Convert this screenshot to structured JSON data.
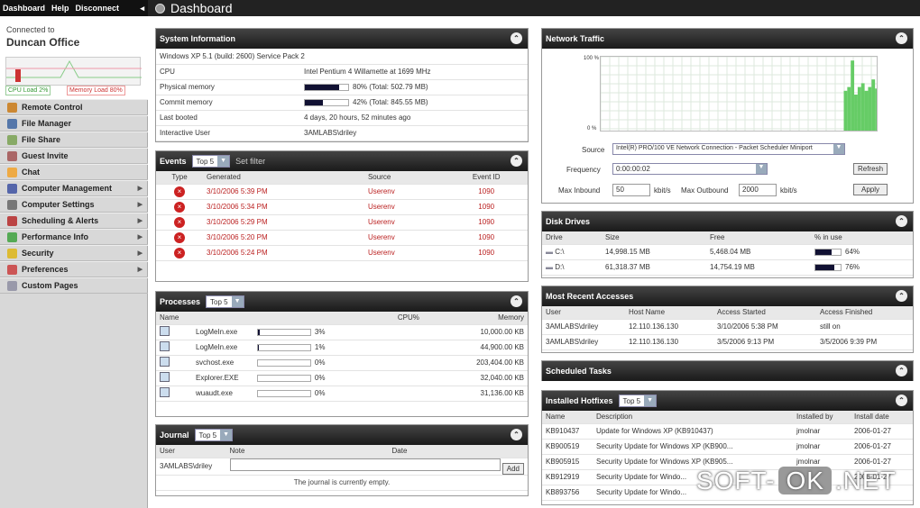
{
  "topnav": {
    "dashboard": "Dashboard",
    "help": "Help",
    "disconnect": "Disconnect",
    "arrow": "◂"
  },
  "page_title": "Dashboard",
  "sidebar": {
    "connected_to": "Connected to",
    "computer": "Duncan Office",
    "cpu_load": "CPU Load 2%",
    "memory_load": "Memory Load 80%",
    "items": [
      {
        "label": "Remote Control",
        "icon": "remote-control-icon",
        "color": "#c83",
        "arrow": false
      },
      {
        "label": "File Manager",
        "icon": "file-manager-icon",
        "color": "#57a",
        "arrow": false
      },
      {
        "label": "File Share",
        "icon": "file-share-icon",
        "color": "#8a6",
        "arrow": false
      },
      {
        "label": "Guest Invite",
        "icon": "guest-invite-icon",
        "color": "#a66",
        "arrow": false
      },
      {
        "label": "Chat",
        "icon": "chat-icon",
        "color": "#ea4",
        "arrow": false
      },
      {
        "label": "Computer Management",
        "icon": "computer-management-icon",
        "color": "#56a",
        "arrow": true
      },
      {
        "label": "Computer Settings",
        "icon": "computer-settings-icon",
        "color": "#777",
        "arrow": true
      },
      {
        "label": "Scheduling & Alerts",
        "icon": "scheduling-icon",
        "color": "#b44",
        "arrow": true
      },
      {
        "label": "Performance Info",
        "icon": "performance-icon",
        "color": "#5a5",
        "arrow": true
      },
      {
        "label": "Security",
        "icon": "security-icon",
        "color": "#db3",
        "arrow": true
      },
      {
        "label": "Preferences",
        "icon": "preferences-icon",
        "color": "#c55",
        "arrow": true
      },
      {
        "label": "Custom Pages",
        "icon": "custom-pages-icon",
        "color": "#99a",
        "arrow": false
      }
    ]
  },
  "sysinfo": {
    "title": "System Information",
    "os": "Windows XP 5.1 (build: 2600) Service Pack 2",
    "rows": [
      {
        "label": "CPU",
        "value": "Intel Pentium 4 Willamette at 1699 MHz"
      },
      {
        "label": "Physical memory",
        "value": "80% (Total: 502.79 MB)",
        "pct": 0.8
      },
      {
        "label": "Commit memory",
        "value": "42% (Total: 845.55 MB)",
        "pct": 0.42
      },
      {
        "label": "Last booted",
        "value": "4 days, 20 hours, 52 minutes ago"
      },
      {
        "label": "Interactive User",
        "value": "3AMLABS\\driley"
      }
    ]
  },
  "events": {
    "title": "Events",
    "select": "Top 5",
    "set_filter": "Set filter",
    "cols": [
      "Type",
      "Generated",
      "Source",
      "Event ID"
    ],
    "rows": [
      {
        "generated": "3/10/2006 5:39 PM",
        "source": "Userenv",
        "id": "1090"
      },
      {
        "generated": "3/10/2006 5:34 PM",
        "source": "Userenv",
        "id": "1090"
      },
      {
        "generated": "3/10/2006 5:29 PM",
        "source": "Userenv",
        "id": "1090"
      },
      {
        "generated": "3/10/2006 5:20 PM",
        "source": "Userenv",
        "id": "1090"
      },
      {
        "generated": "3/10/2006 5:24 PM",
        "source": "Userenv",
        "id": "1090"
      }
    ]
  },
  "processes": {
    "title": "Processes",
    "select": "Top 5",
    "cols": [
      "Name",
      "CPU%",
      "Memory"
    ],
    "rows": [
      {
        "name": "LogMeIn.exe",
        "cpu": "3%",
        "pct": 0.03,
        "mem": "10,000.00 KB"
      },
      {
        "name": "LogMeIn.exe",
        "cpu": "1%",
        "pct": 0.01,
        "mem": "44,900.00 KB"
      },
      {
        "name": "svchost.exe",
        "cpu": "0%",
        "pct": 0,
        "mem": "203,404.00 KB"
      },
      {
        "name": "Explorer.EXE",
        "cpu": "0%",
        "pct": 0,
        "mem": "32,040.00 KB"
      },
      {
        "name": "wuaudt.exe",
        "cpu": "0%",
        "pct": 0,
        "mem": "31,136.00 KB"
      }
    ]
  },
  "journal": {
    "title": "Journal",
    "select": "Top 5",
    "cols": [
      "User",
      "Note",
      "Date"
    ],
    "user": "3AMLABS\\driley",
    "add": "Add",
    "empty": "The journal is currently empty."
  },
  "network": {
    "title": "Network Traffic",
    "y_top": "100 %",
    "y_bottom": "0 %",
    "source_label": "Source",
    "source_value": "Intel(R) PRO/100 VE Network Connection - Packet Scheduler Miniport",
    "frequency_label": "Frequency",
    "frequency_value": "0:00:00:02",
    "refresh": "Refresh",
    "max_in_label": "Max Inbound",
    "max_in": "50",
    "unit": "kbit/s",
    "max_out_label": "Max Outbound",
    "max_out": "2000",
    "apply": "Apply",
    "traffic_pct": [
      0,
      0,
      0,
      0,
      0,
      0,
      0,
      0,
      0,
      0,
      0,
      0,
      0,
      0,
      0,
      0,
      0,
      0,
      0,
      0,
      0,
      0,
      0,
      0,
      0,
      0,
      0,
      0,
      0,
      0,
      0,
      0,
      0,
      0,
      0,
      0,
      0,
      0,
      0,
      0,
      0,
      0,
      0,
      0,
      0,
      0,
      0,
      0,
      0,
      0,
      0,
      0,
      0,
      0,
      0,
      0,
      0,
      0,
      0,
      0,
      0,
      0,
      0,
      0,
      0,
      0,
      0,
      0,
      0,
      0,
      55,
      60,
      95,
      50,
      60,
      65,
      55,
      60,
      70,
      58
    ]
  },
  "disks": {
    "title": "Disk Drives",
    "cols": [
      "Drive",
      "Size",
      "Free",
      "% in use"
    ],
    "rows": [
      {
        "drive": "C:\\",
        "size": "14,998.15 MB",
        "free": "5,468.04 MB",
        "use": "64%",
        "pct": 0.64
      },
      {
        "drive": "D:\\",
        "size": "61,318.37 MB",
        "free": "14,754.19 MB",
        "use": "76%",
        "pct": 0.76
      }
    ]
  },
  "accesses": {
    "title": "Most Recent Accesses",
    "cols": [
      "User",
      "Host Name",
      "Access Started",
      "Access Finished"
    ],
    "rows": [
      {
        "user": "3AMLABS\\driley",
        "host": "12.110.136.130",
        "started": "3/10/2006 5:38 PM",
        "finished": "still on"
      },
      {
        "user": "3AMLABS\\driley",
        "host": "12.110.136.130",
        "started": "3/5/2006 9:13 PM",
        "finished": "3/5/2006 9:39 PM"
      }
    ]
  },
  "tasks": {
    "title": "Scheduled Tasks"
  },
  "hotfixes": {
    "title": "Installed Hotfixes",
    "select": "Top 5",
    "cols": [
      "Name",
      "Description",
      "Installed by",
      "Install date"
    ],
    "rows": [
      {
        "name": "KB910437",
        "desc": "Update for Windows XP (KB910437)",
        "by": "jmolnar",
        "date": "2006-01-27"
      },
      {
        "name": "KB900519",
        "desc": "Security Update for Windows XP (KB900...",
        "by": "jmolnar",
        "date": "2006-01-27"
      },
      {
        "name": "KB905915",
        "desc": "Security Update for Windows XP (KB905...",
        "by": "jmolnar",
        "date": "2006-01-27"
      },
      {
        "name": "KB912919",
        "desc": "Security Update for Windo...",
        "by": "",
        "date": "2006-01-27"
      },
      {
        "name": "KB893756",
        "desc": "Security Update for Windo...",
        "by": "",
        "date": ""
      }
    ]
  },
  "watermark": {
    "a": "SOFT-",
    "b": "OK",
    "c": ".NET"
  }
}
